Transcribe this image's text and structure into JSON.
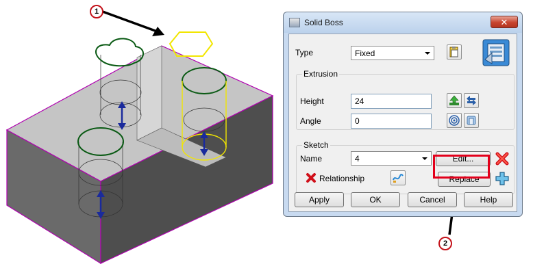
{
  "dialog": {
    "title": "Solid Boss",
    "close_glyph": "✕",
    "type": {
      "label": "Type",
      "value": "Fixed"
    },
    "extrusion": {
      "group_label": "Extrusion",
      "height": {
        "label": "Height",
        "value": "24"
      },
      "angle": {
        "label": "Angle",
        "value": "0"
      }
    },
    "sketch": {
      "group_label": "Sketch",
      "name": {
        "label": "Name",
        "value": "4"
      },
      "edit_label": "Edit...",
      "relationship_label": "Relationship",
      "replace_label": "Replace"
    },
    "buttons": {
      "apply": "Apply",
      "ok": "OK",
      "cancel": "Cancel",
      "help": "Help"
    }
  },
  "callouts": {
    "one": "1",
    "two": "2"
  },
  "colors": {
    "dialog_frame": "#c8daf0",
    "highlight": "#e3001b",
    "solid_top": "#c5c5c5",
    "solid_front": "#6a6a6a",
    "solid_side": "#4e4e4e",
    "edge": "#b000b0",
    "sketch_green": "#0a5a14",
    "sketch_yellow": "#f2e600",
    "arrow_blue": "#1a2a9c"
  }
}
